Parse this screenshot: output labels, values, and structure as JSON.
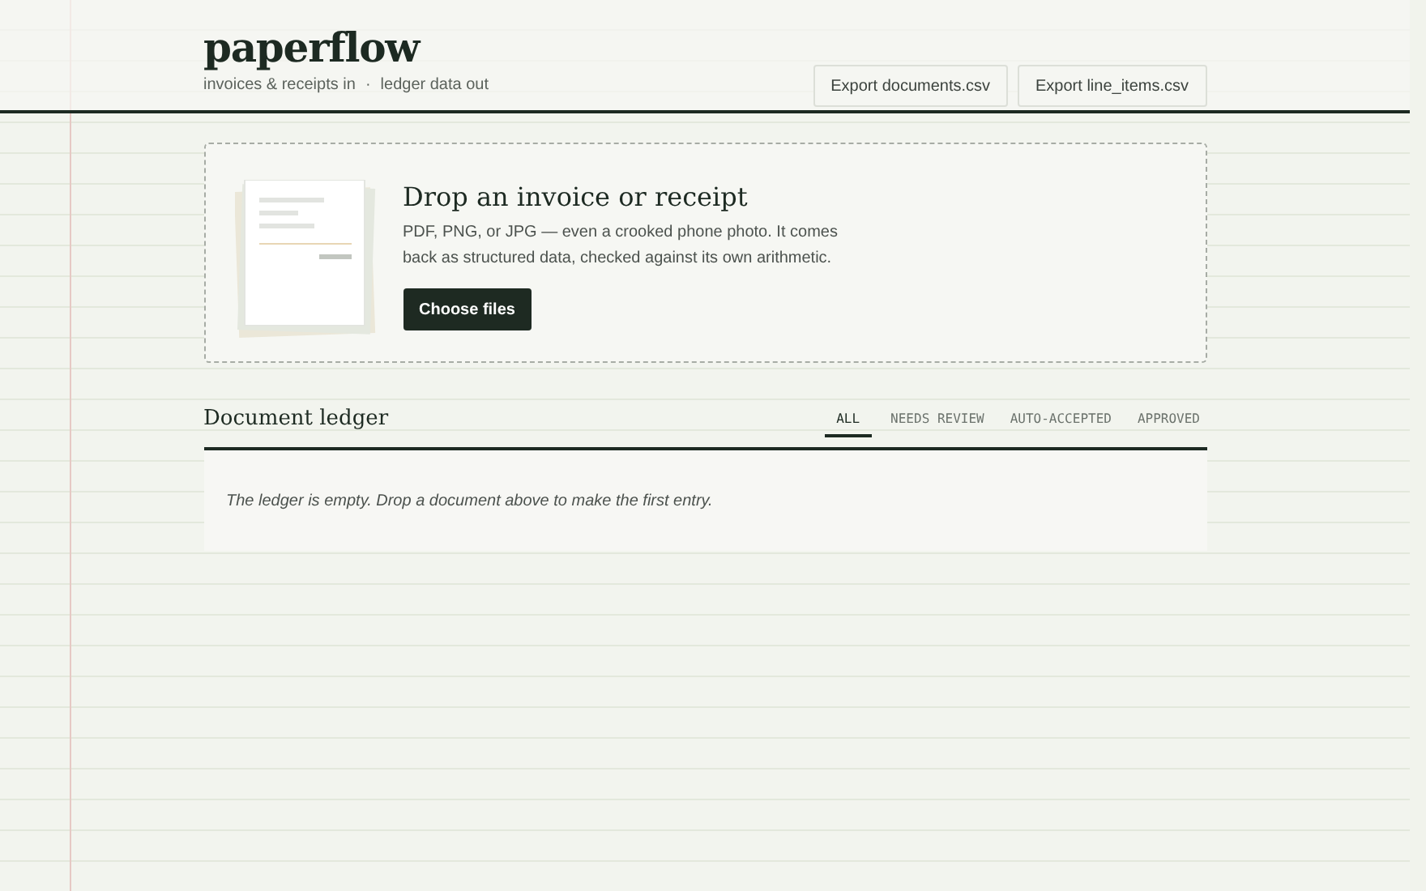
{
  "brand": {
    "title": "paperflow",
    "tagline_left": "invoices & receipts in",
    "separator": "·",
    "tagline_right": "ledger data out"
  },
  "export_buttons": [
    "Export documents.csv",
    "Export line_items.csv"
  ],
  "dropzone": {
    "title": "Drop an invoice or receipt",
    "description": "PDF, PNG, or JPG — even a crooked phone photo. It comes back as structured data, checked against its own arithmetic.",
    "button": "Choose files"
  },
  "ledger": {
    "title": "Document ledger",
    "tabs": [
      {
        "label": "ALL",
        "selected": true
      },
      {
        "label": "NEEDS REVIEW",
        "selected": false
      },
      {
        "label": "AUTO-ACCEPTED",
        "selected": false
      },
      {
        "label": "APPROVED",
        "selected": false
      }
    ],
    "empty_message": "The ledger is empty. Drop a document above to make the first entry."
  }
}
